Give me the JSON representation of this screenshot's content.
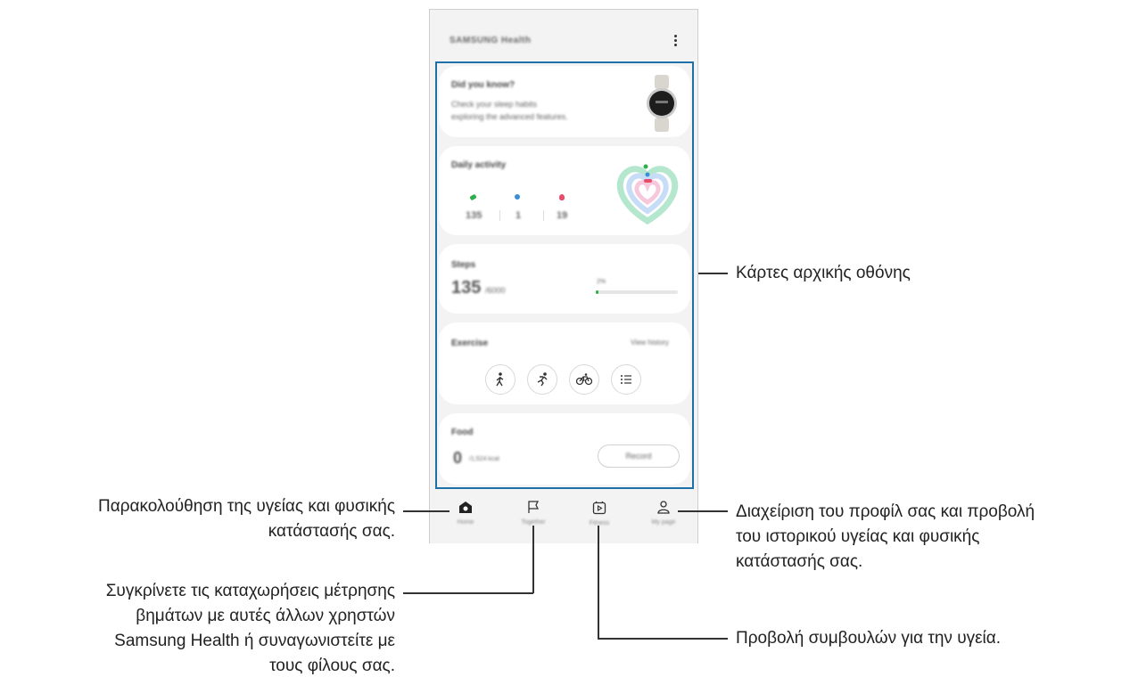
{
  "app": {
    "title": "SAMSUNG Health"
  },
  "cards": {
    "tip": {
      "title": "Did you know?",
      "body_line1": "Check your sleep habits",
      "body_line2": "exploring the advanced features."
    },
    "daily_activity": {
      "title": "Daily activity",
      "stats": [
        "135",
        "1",
        "19"
      ]
    },
    "steps": {
      "title": "Steps",
      "value": "135",
      "unit": "/6000",
      "percent_label": "2%"
    },
    "exercise": {
      "title": "Exercise",
      "link": "View history"
    },
    "food": {
      "title": "Food",
      "value": "0",
      "unit": "/1,524 kcal",
      "button": "Record"
    }
  },
  "nav": {
    "items": [
      "Home",
      "Together",
      "Fitness",
      "My page"
    ]
  },
  "annotations": {
    "home_cards": "Κάρτες αρχικής οθόνης",
    "home_line1": "Παρακολούθηση της υγείας και φυσικής",
    "home_line2": "κατάστασής σας.",
    "together_line1": "Συγκρίνετε τις καταχωρήσεις μέτρησης",
    "together_line2": "βημάτων με αυτές άλλων χρηστών",
    "together_line3": "Samsung Health ή συναγωνιστείτε με",
    "together_line4": "τους φίλους σας.",
    "mypage_line1": "Διαχείριση του προφίλ σας και προβολή",
    "mypage_line2": "του ιστορικού υγείας και φυσικής",
    "mypage_line3": "κατάστασής σας.",
    "fitness_line1": "Προβολή συμβουλών για την υγεία."
  },
  "colors": {
    "highlight": "#1f6fa8",
    "steps_bar": "#2fae4e"
  }
}
